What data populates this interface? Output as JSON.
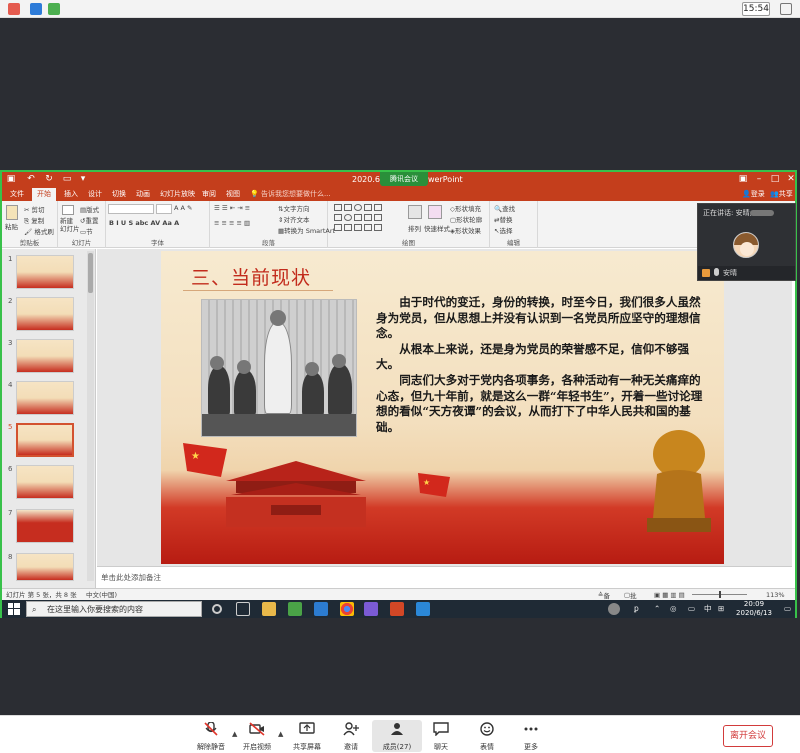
{
  "status_bar": {
    "time": "15:54"
  },
  "ppt": {
    "title": "2020.6.1",
    "title_suffix": "werPoint",
    "meeting_badge": "腾讯会议",
    "tabs": [
      "文件",
      "开始",
      "插入",
      "设计",
      "切换",
      "动画",
      "幻灯片放映",
      "审阅",
      "视图"
    ],
    "active_tab": "开始",
    "tell_me": "告诉我您想要做什么...",
    "sign_in": "登录",
    "share": "共享",
    "ribbon": {
      "groups": [
        "剪贴板",
        "幻灯片",
        "字体",
        "段落",
        "绘图",
        "编辑"
      ],
      "paste": "粘贴",
      "cut": "剪切",
      "copy": "复制",
      "format_painter": "格式刷",
      "new_slide": "新建\n幻灯片",
      "layout": "版式",
      "reset": "重置",
      "section": "节",
      "text_direction": "文字方向",
      "align_text": "对齐文本",
      "smartart": "转换为 SmartArt",
      "arrange": "排列",
      "quick_styles": "快速样式",
      "shape_fill": "形状填充",
      "shape_outline": "形状轮廓",
      "shape_effects": "形状效果",
      "find": "查找",
      "replace": "替换",
      "select": "选择"
    },
    "thumbnails": [
      "1",
      "2",
      "3",
      "4",
      "5",
      "6",
      "7",
      "8"
    ],
    "selected_slide": 5,
    "slide": {
      "heading": "三、当前现状",
      "paragraphs": [
        "由于时代的变迁，身份的转换，时至今日，我们很多人虽然身为党员，但从思想上并没有认识到一名党员所应坚守的理想信念。",
        "从根本上来说，还是身为党员的荣誉感不足，信仰不够强大。",
        "同志们大多对于党内各项事务，各种活动有一种无关痛痒的心态，但九十年前，就是这么一群“年轻书生”，开着一些讨论理想的看似“天方夜谭”的会议，从而打下了中华人民共和国的基础。"
      ]
    },
    "notes_placeholder": "单击此处添加备注",
    "status": {
      "slide_count": "幻灯片 第 5 张，共 8 张",
      "language": "中文(中国)",
      "notes": "备注",
      "comments": "批注",
      "zoom": "113%"
    }
  },
  "taskbar": {
    "search_placeholder": "在这里输入你要搜索的内容",
    "ime": "中",
    "time": "20:09",
    "date": "2020/6/13"
  },
  "speaker": {
    "label": "正在讲话: 安晴;",
    "name": "安晴"
  },
  "toolbar": {
    "unmute": "解除静音",
    "start_video": "开启视频",
    "share_screen": "共享屏幕",
    "invite": "邀请",
    "members": "成员(27)",
    "chat": "聊天",
    "reactions": "表情",
    "more": "更多",
    "leave": "离开会议"
  },
  "colors": {
    "ppt_accent": "#c43e1c",
    "share_border": "#38c14a",
    "leave_red": "#d23b3b"
  }
}
